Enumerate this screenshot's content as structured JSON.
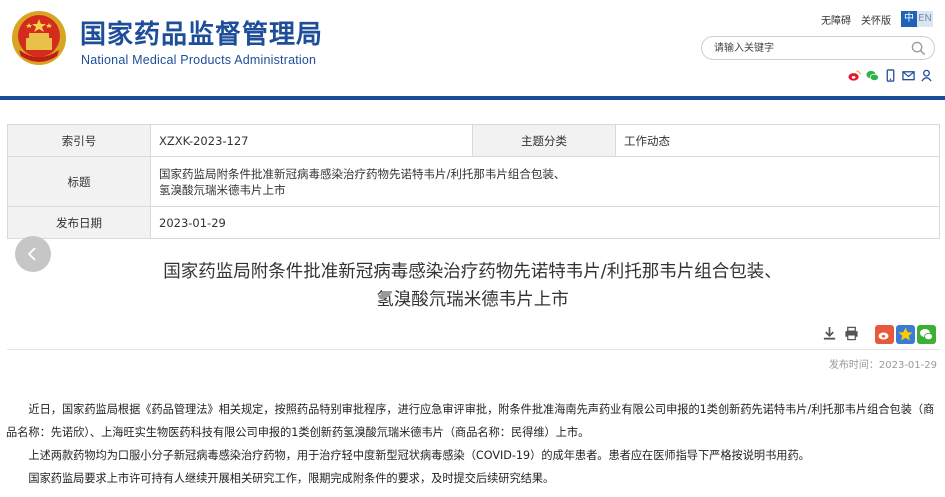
{
  "header": {
    "title_cn": "国家药品监督管理局",
    "title_en": "National Medical Products Administration",
    "links": [
      "无障碍",
      "关怀版"
    ],
    "lang_cn": "中",
    "lang_en": "EN",
    "search_placeholder": "请输入关键字",
    "share_icons": [
      "weibo-icon",
      "wechat-icon",
      "mobile-icon",
      "email-icon",
      "user-icon"
    ],
    "colors": {
      "brand_blue": "#1e4e9a",
      "bar_blue": "#1a4c97"
    }
  },
  "info": {
    "index_label": "索引号",
    "index_value": "XZXK-2023-127",
    "topic_label": "主题分类",
    "topic_value": "工作动态",
    "title_label": "标题",
    "title_value_line1": "国家药监局附条件批准新冠病毒感染治疗药物先诺特韦片/利托那韦片组合包装、",
    "title_value_line2": "氢溴酸氘瑞米德韦片上市",
    "date_label": "发布日期",
    "date_value": "2023-01-29"
  },
  "article": {
    "title_line1": "国家药监局附条件批准新冠病毒感染治疗药物先诺特韦片/利托那韦片组合包装、",
    "title_line2": "氢溴酸氘瑞米德韦片上市",
    "tools": [
      "download-icon",
      "print-icon"
    ],
    "social": [
      "weibo-share-icon",
      "favorite-icon",
      "wechat-share-icon"
    ],
    "pub_date": "发布时间：2023-01-29",
    "paragraphs": [
      "近日，国家药监局根据《药品管理法》相关规定，按照药品特别审批程序，进行应急审评审批，附条件批准海南先声药业有限公司申报的1类创新药先诺特韦片/利托那韦片组合包装（商品名称：先诺欣）、上海旺实生物医药科技有限公司申报的1类创新药氢溴酸氘瑞米德韦片（商品名称：民得维）上市。",
      "上述两款药物均为口服小分子新冠病毒感染治疗药物，用于治疗轻中度新型冠状病毒感染（COVID-19）的成年患者。患者应在医师指导下严格按说明书用药。",
      "国家药监局要求上市许可持有人继续开展相关研究工作，限期完成附条件的要求，及时提交后续研究结果。"
    ]
  }
}
